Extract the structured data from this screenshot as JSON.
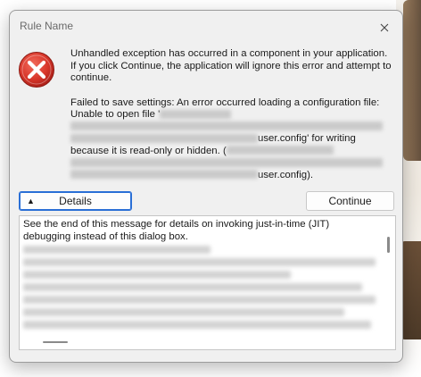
{
  "window": {
    "title": "Rule Name"
  },
  "icons": {
    "error": "error-icon",
    "close": "close-icon",
    "details_arrow": "triangle-up-icon"
  },
  "message": {
    "intro": "Unhandled exception has occurred in a component in your application. If you click Continue, the application will ignore this error and attempt to continue.",
    "line1": "Failed to save settings: An error occurred loading a configuration file:",
    "line2_prefix": "Unable to open file '",
    "line4_suffix": "user.config' for writing",
    "line5": "because it is read-only or hidden. (",
    "line6_suffix": "user.config)."
  },
  "buttons": {
    "details": "Details",
    "continue": "Continue"
  },
  "details": {
    "intro": "See the end of this message for details on invoking just-in-time (JIT) debugging instead of this dialog box."
  },
  "colors": {
    "error_red": "#d32f2f",
    "focus_blue": "#2a6fd6",
    "dialog_bg": "#f0f0f0"
  }
}
